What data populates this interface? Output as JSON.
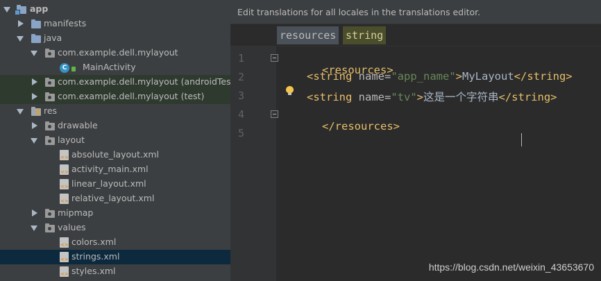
{
  "tree": {
    "items": [
      {
        "label": "app",
        "dim": ""
      },
      {
        "label": "manifests",
        "dim": ""
      },
      {
        "label": "java",
        "dim": ""
      },
      {
        "label": "com.example.dell.mylayout",
        "dim": ""
      },
      {
        "label": "MainActivity",
        "dim": ""
      },
      {
        "label": "com.example.dell.mylayout",
        "dim": "(androidTest)"
      },
      {
        "label": "com.example.dell.mylayout",
        "dim": "(test)"
      },
      {
        "label": "res",
        "dim": ""
      },
      {
        "label": "drawable",
        "dim": ""
      },
      {
        "label": "layout",
        "dim": ""
      },
      {
        "label": "absolute_layout.xml",
        "dim": ""
      },
      {
        "label": "activity_main.xml",
        "dim": ""
      },
      {
        "label": "linear_layout.xml",
        "dim": ""
      },
      {
        "label": "relative_layout.xml",
        "dim": ""
      },
      {
        "label": "mipmap",
        "dim": ""
      },
      {
        "label": "values",
        "dim": ""
      },
      {
        "label": "colors.xml",
        "dim": ""
      },
      {
        "label": "strings.xml",
        "dim": ""
      },
      {
        "label": "styles.xml",
        "dim": ""
      }
    ],
    "class_icon_letter": "C"
  },
  "editor": {
    "banner": "Edit translations for all locales in the translations editor.",
    "breadcrumbs": [
      "resources",
      "string"
    ],
    "line_numbers": [
      "1",
      "2",
      "3",
      "4",
      "5"
    ],
    "code": {
      "l1": {
        "open": "<resources>"
      },
      "l2": {
        "open": "<string ",
        "attr": "name=",
        "val": "\"app_name\"",
        "close": ">",
        "text": "MyLayout",
        "end": "</string>"
      },
      "l3": {
        "open": "<string ",
        "attr": "name=",
        "val": "\"tv\"",
        "close": ">",
        "text": "这是一个字符串",
        "end": "</string>"
      },
      "l4": {
        "open": "</resources>"
      }
    }
  },
  "watermark": "https://blog.csdn.net/weixin_43653670"
}
